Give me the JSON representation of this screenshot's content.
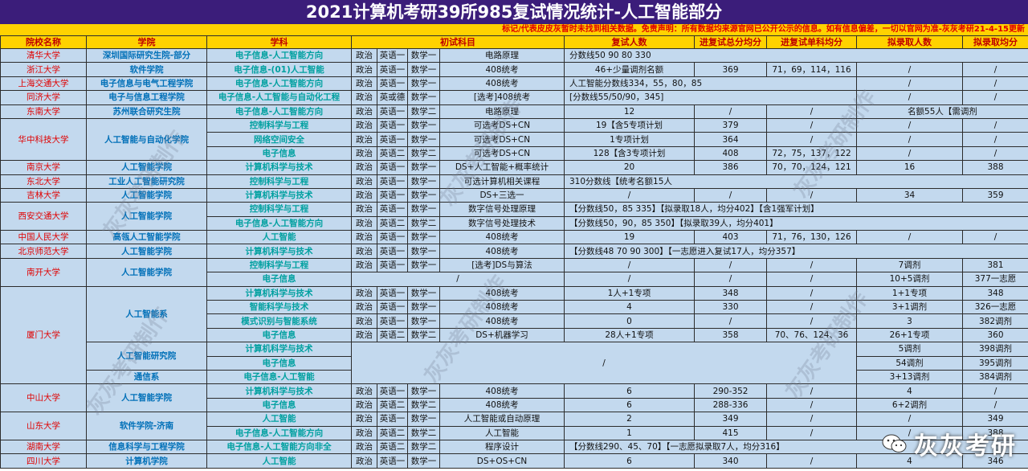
{
  "title": "2021计算机考研39所985复试情况统计-人工智能部分",
  "note": "标记/代表皮皮灰暂时未找到相关数据。免责声明：所有数据均来源官网已公开公示的信息。如有信息偏差，一切以官网为准-灰灰考研21-4-15更新",
  "headers": [
    "院校名称",
    "学院",
    "学科",
    "初试科目",
    "复试人数",
    "进复试总分均分",
    "进复试单科均分",
    "拟录取人数",
    "拟录取均分"
  ],
  "rows": [
    {
      "univ": "清华大学",
      "college": "深圳国际研究生院-部分",
      "major": "电子信息-人工智能方向",
      "s1": "政治",
      "s2": "英语一",
      "s3": "数学一",
      "s4": "电路原理",
      "span": {
        "text": "分数线50 90 80 330",
        "cols": 5
      }
    },
    {
      "univ": "浙江大学",
      "college": "软件学院",
      "major": "电子信息-(01)人工智能",
      "s1": "政治",
      "s2": "英语一",
      "s3": "数学一",
      "s4": "408统考",
      "c": [
        "46+少量调剂名额",
        "369",
        "71，69，114，116",
        "/",
        "/"
      ]
    },
    {
      "univ": "上海交通大学",
      "college": "电子信息与电气工程学院",
      "major": "电子信息-人工智能方向",
      "s1": "政治",
      "s2": "英语一",
      "s3": "数学一",
      "s4": "408统考",
      "span": {
        "text": "人工智能分数线334，55，80，85",
        "cols": 3
      },
      "c2": [
        "/",
        "/"
      ]
    },
    {
      "univ": "同济大学",
      "college": "电子与信息工程学院",
      "major": "电子信息-人工智能与自动化工程",
      "s1": "政治",
      "s2": "英或德",
      "s3": "数学一",
      "s4": "[选考]408统考",
      "span": {
        "text": "[分数线55/50/90，345]",
        "cols": 3
      },
      "c2": [
        "/",
        "/"
      ]
    },
    {
      "univ": "东南大学",
      "college": "苏州联合研究生院",
      "major": "电子信息-人工智能方向",
      "s1": "政治",
      "s2": "英语一",
      "s3": "数学二",
      "s4": "电路原理",
      "c": [
        "12",
        "/",
        "/"
      ],
      "span2": {
        "text": "名额55人【需调剂",
        "cols": 2
      }
    },
    {
      "univ": "华中科技大学",
      "college": "人工智能与自动化学院",
      "major": "控制科学与工程",
      "s1": "政治",
      "s2": "英语一",
      "s3": "数学一",
      "s4": "可选考DS+CN",
      "c": [
        "19【含5专项计划",
        "379",
        "/",
        "/",
        "/"
      ]
    },
    {
      "major": "网络空间安全",
      "s1": "政治",
      "s2": "英语一",
      "s3": "数学一",
      "s4": "可选考DS+CN",
      "c": [
        "1专项计划",
        "364",
        "/",
        "/",
        "/"
      ]
    },
    {
      "major": "电子信息",
      "s1": "政治",
      "s2": "英语二",
      "s3": "数学二",
      "s4": "可选考DS+CN",
      "c": [
        "128【含3专项计划",
        "408",
        "72，75，137，122",
        "/",
        "/"
      ]
    },
    {
      "univ": "南京大学",
      "college": "人工智能学院",
      "major": "计算机科学与技术",
      "s1": "政治",
      "s2": "英语一",
      "s3": "数学一",
      "s4": "DS+人工智能+概率统计",
      "c": [
        "20",
        "386",
        "70，70，124，121",
        "16",
        "388"
      ]
    },
    {
      "univ": "东北大学",
      "college": "工业人工智能研究院",
      "major": "控制科学与工程",
      "s1": "政治",
      "s2": "英语一",
      "s3": "数学一",
      "s4": "可选计算机相关课程",
      "span": {
        "text": "310分数线【统考名额15人",
        "cols": 5
      }
    },
    {
      "univ": "吉林大学",
      "college": "人工智能学院",
      "major": "计算机科学与技术",
      "s1": "政治",
      "s2": "英语一",
      "s3": "数学一",
      "s4": "DS+三选一",
      "c": [
        "/",
        "/",
        "/",
        "34",
        "359"
      ]
    },
    {
      "univ": "西安交通大学",
      "college": "人工智能学院",
      "major": "控制科学与工程",
      "s1": "政治",
      "s2": "英语一",
      "s3": "数学一",
      "s4": "数字信号处理原理",
      "span": {
        "text": "【分数线50，85 335】【拟录取18人，均分402】【含1强军计划】",
        "cols": 5
      }
    },
    {
      "major": "电子信息-人工智能方向",
      "s1": "政治",
      "s2": "英语二",
      "s3": "数学二",
      "s4": "数字信号处理技术",
      "span": {
        "text": "【分数线50，90，85 350】【拟录取39人，均分401】",
        "cols": 5
      }
    },
    {
      "univ": "中国人民大学",
      "college": "高瓴人工智能学院",
      "major": "人工智能",
      "s1": "政治",
      "s2": "英语一",
      "s3": "数学一",
      "s4": "408统考",
      "c": [
        "19",
        "403",
        "71，76，130，126",
        "/",
        "/"
      ]
    },
    {
      "univ": "北京师范大学",
      "college": "人工智能学院",
      "major": "计算机科学与技术",
      "s1": "政治",
      "s2": "英语一",
      "s3": "数学一",
      "s4": "408统考",
      "span": {
        "text": "【分数线48 70 90 300】【一志愿进入复试17人，均分357】",
        "cols": 5
      }
    },
    {
      "univ": "南开大学",
      "college": "人工智能学院",
      "major": "控制科学与工程",
      "s1": "政治",
      "s2": "英语一",
      "s3": "数学一",
      "s4": "[选考]DS与算法",
      "c": [
        "/",
        "/",
        "/",
        "7调剂",
        "381"
      ]
    },
    {
      "major": "电子信息",
      "span3": "/",
      "c": [
        "/",
        "/",
        "/",
        "10+5调剂",
        "377一志愿"
      ]
    },
    {
      "univ": "厦门大学",
      "college": "人工智能系",
      "major": "计算机科学与技术",
      "s1": "政治",
      "s2": "英语一",
      "s3": "数学一",
      "s4": "408统考",
      "c": [
        "1人+1专项",
        "348",
        "/",
        "1+1专项",
        "348"
      ]
    },
    {
      "major": "智能科学与技术",
      "s1": "政治",
      "s2": "英语一",
      "s3": "数学一",
      "s4": "408统考",
      "c": [
        "4",
        "330",
        "/",
        "3+1调剂",
        "326一志愿"
      ]
    },
    {
      "major": "模式识别与智能系统",
      "s1": "政治",
      "s2": "英语一",
      "s3": "数学一",
      "s4": "408统考",
      "c": [
        "0",
        "/",
        "/",
        "3",
        "382调剂"
      ]
    },
    {
      "major": "电子信息",
      "s1": "政治",
      "s2": "英语二",
      "s3": "数学二",
      "s4": "DS+机器学习",
      "c": [
        "28人+1专项",
        "358",
        "70、76、124、36",
        "26+1专项",
        "360"
      ]
    },
    {
      "college": "人工智能研究院",
      "major": "计算机科学与技术",
      "big": "/",
      "c": [
        "5调剂",
        "398调剂"
      ]
    },
    {
      "major": "电子信息",
      "c": [
        "54调剂",
        "395调剂"
      ]
    },
    {
      "college": "通信系",
      "major": "电子信息-人工智能",
      "c": [
        "3+13调剂",
        "384调剂"
      ]
    },
    {
      "univ": "中山大学",
      "college": "人工智能学院",
      "major": "计算机科学与技术",
      "s1": "政治",
      "s2": "英语一",
      "s3": "数学一",
      "s4": "408统考",
      "c": [
        "6",
        "290-352",
        "/",
        "4",
        "/"
      ]
    },
    {
      "major": "电子信息",
      "s1": "政治",
      "s2": "英语二",
      "s3": "数学二",
      "s4": "408统考",
      "c": [
        "6",
        "288-336",
        "/",
        "6+2调剂",
        "/"
      ]
    },
    {
      "univ": "山东大学",
      "college": "软件学院-济南",
      "major": "人工智能",
      "s1": "政治",
      "s2": "英语一",
      "s3": "数学一",
      "s4": "人工智能或自动原理",
      "c": [
        "2",
        "349",
        "/",
        "/",
        "349"
      ]
    },
    {
      "major": "电子信息-人工智能方向",
      "s1": "政治",
      "s2": "英语二",
      "s3": "数学二",
      "s4": "人工智能",
      "c": [
        "1",
        "415",
        "/",
        "/",
        "388"
      ]
    },
    {
      "univ": "湖南大学",
      "college": "信息科学与工程学院",
      "major": "电子信息-人工智能方向非全",
      "s1": "政治",
      "s2": "英语二",
      "s3": "数学二",
      "s4": "程序设计",
      "span": {
        "text": "【分数线290、45、70】【一志愿拟录取7人，均分316】",
        "cols": 5
      }
    },
    {
      "univ": "四川大学",
      "college": "计算机学院",
      "major": "人工智能",
      "s1": "政治",
      "s2": "英语一",
      "s3": "数学一",
      "s4": "DS+OS+CN",
      "c": [
        "6",
        "340",
        "/",
        "4",
        "346"
      ]
    }
  ],
  "watermark": "灰灰考研制作",
  "brand": "灰灰考研",
  "brand_icon": "wechat-icon"
}
